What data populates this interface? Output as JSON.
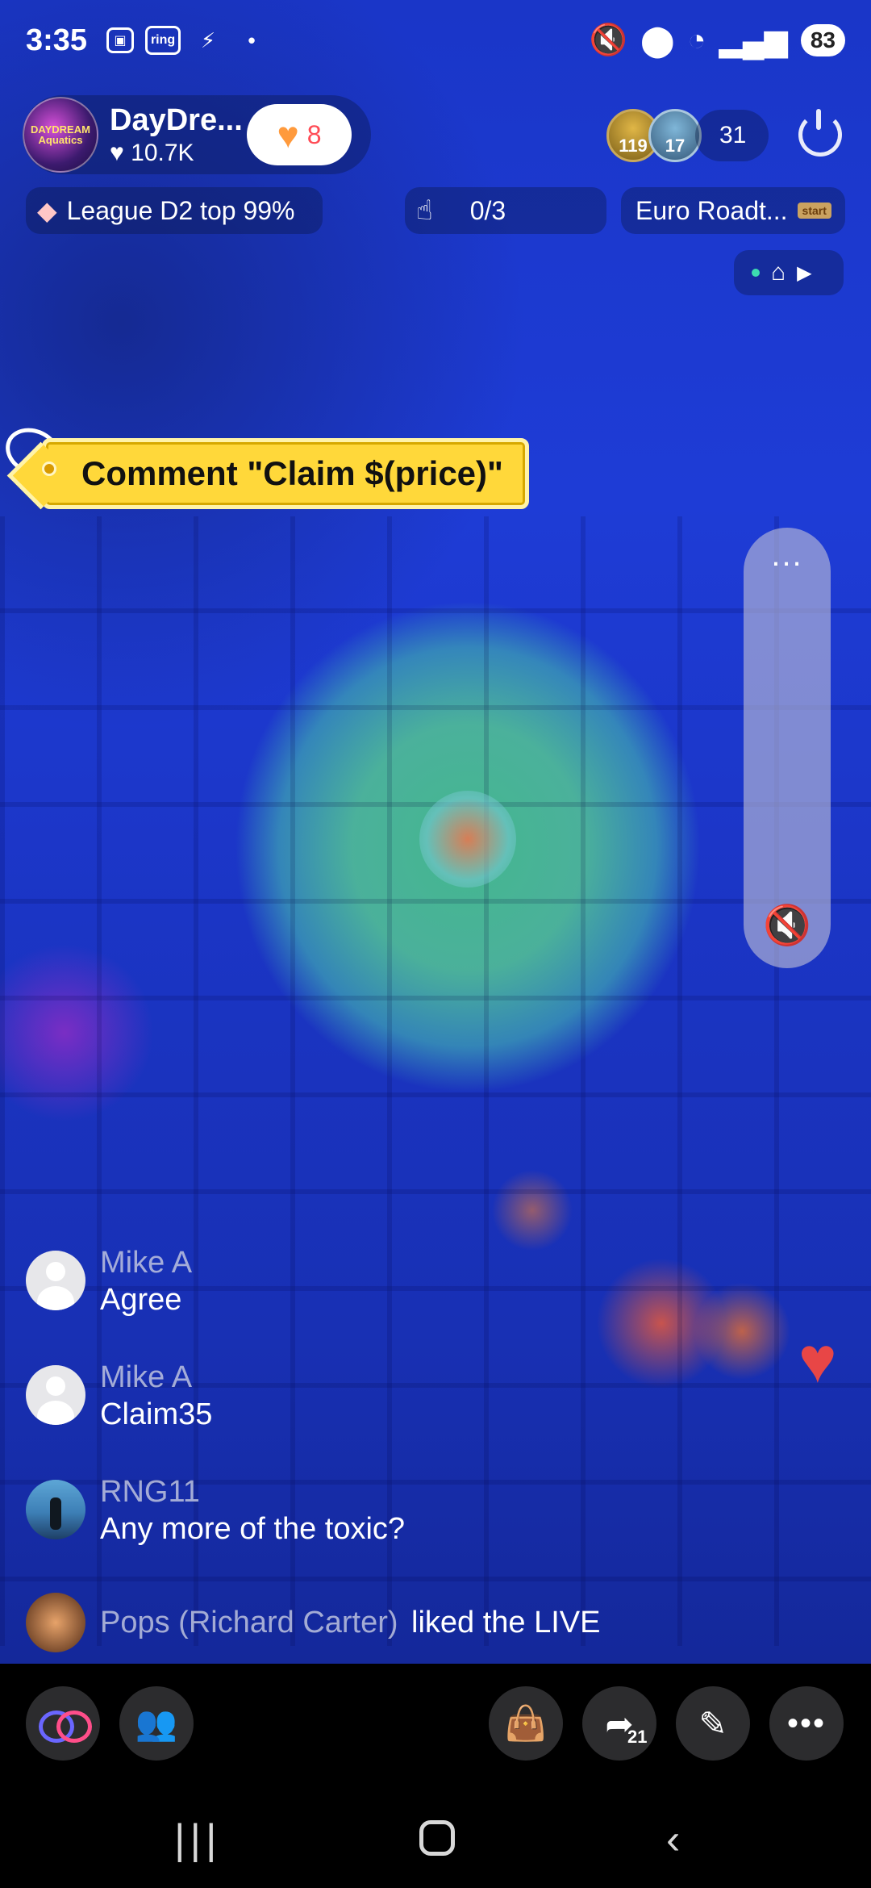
{
  "status_bar": {
    "time": "3:35",
    "left_icons": [
      "screenshot-icon",
      "ring-icon",
      "messenger-icon",
      "dot-icon"
    ],
    "ring_label": "ring",
    "battery": "83",
    "wifi_label": "6"
  },
  "host": {
    "avatar_text": "DAYDREAM Aquatics",
    "name": "DayDre...",
    "likes": "10.7K",
    "follow_count": "8"
  },
  "viewers": {
    "badge1": "119",
    "badge2": "17",
    "count": "31"
  },
  "chips": {
    "league": "League D2 top 99%",
    "goal": "0/3",
    "euro": "Euro Roadt...",
    "euro_sign": "start"
  },
  "claim_tag": {
    "text": "Comment \"Claim $(price)\""
  },
  "side_panel": {
    "more_label": "..."
  },
  "comments": [
    {
      "name": "Mike A",
      "text": "Agree"
    },
    {
      "name": "Mike A",
      "text": "Claim35"
    },
    {
      "name": "RNG11",
      "text": "Any more of the toxic?"
    }
  ],
  "activity": {
    "name": "Pops (Richard Carter)",
    "text": "liked the LIVE"
  },
  "bottom_bar": {
    "share_count": "21",
    "more_label": "•••"
  },
  "colors": {
    "claim_tag": "#ffd83a",
    "heart": "#e84646",
    "follow_heart": "#ff9a3c",
    "accent_pink": "#ff4e8a"
  }
}
